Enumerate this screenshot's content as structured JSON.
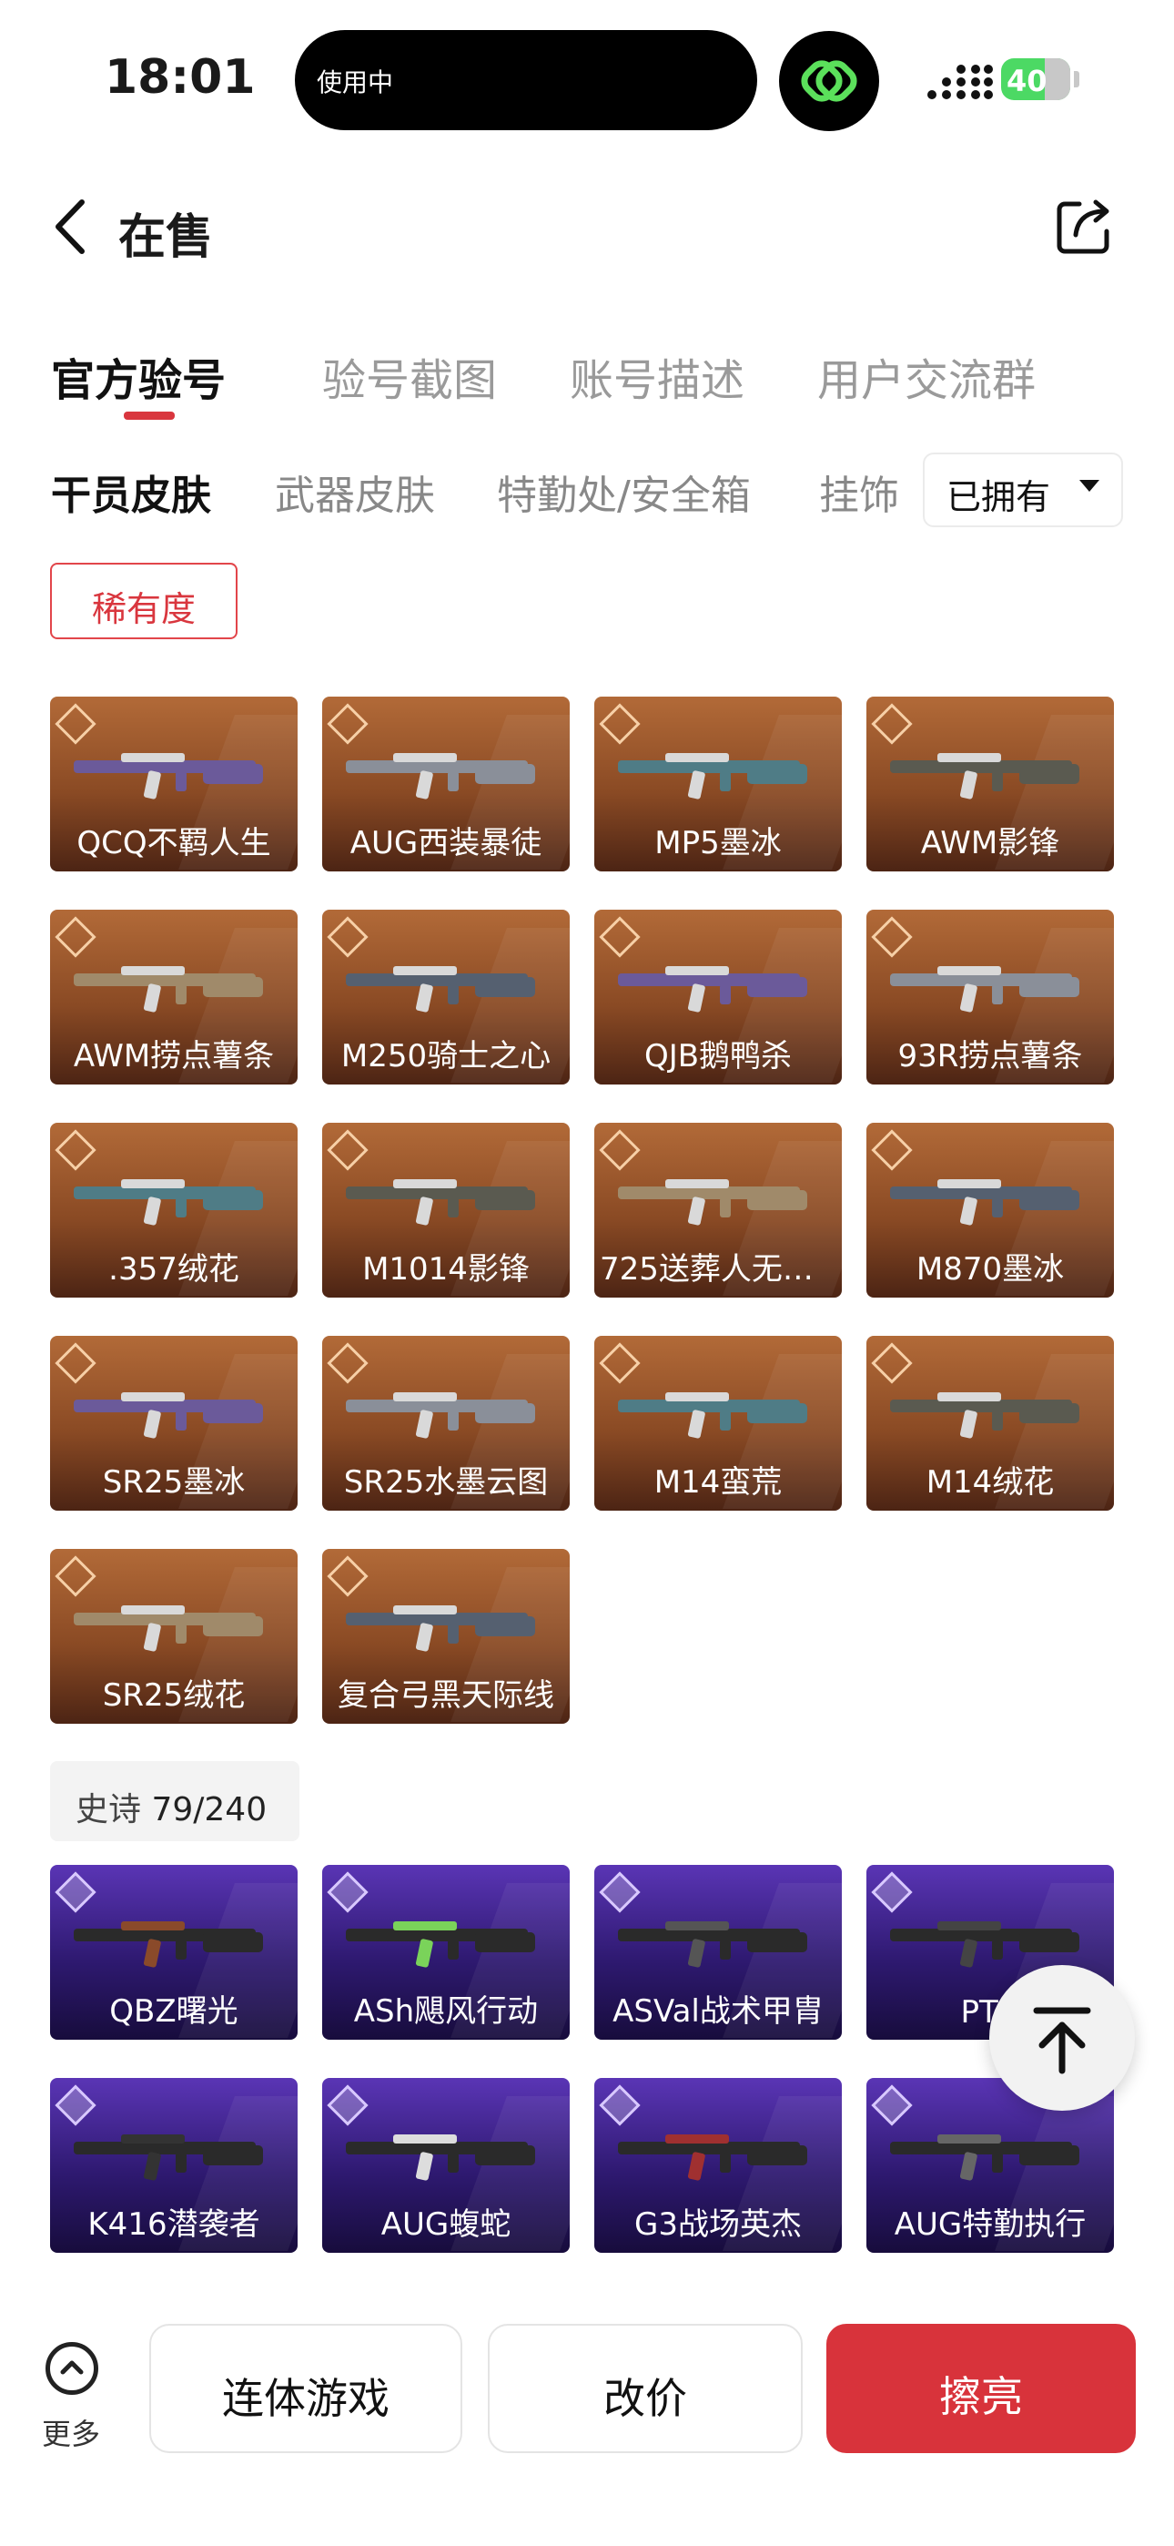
{
  "status_bar": {
    "time": "18:01",
    "island_text": "使用中",
    "battery": "40"
  },
  "header": {
    "title": "在售"
  },
  "main_tabs": [
    {
      "label": "官方验号",
      "active": true
    },
    {
      "label": "验号截图",
      "active": false
    },
    {
      "label": "账号描述",
      "active": false
    },
    {
      "label": "用户交流群",
      "active": false
    }
  ],
  "sub_tabs": [
    {
      "label": "干员皮肤",
      "active": true
    },
    {
      "label": "武器皮肤",
      "active": false
    },
    {
      "label": "特勤处/安全箱",
      "active": false
    },
    {
      "label": "挂饰",
      "active": false
    }
  ],
  "owned_filter": {
    "selected": "已拥有"
  },
  "rarity_filter": "稀有度",
  "legendary_items": [
    "QCQ不羁人生",
    "AUG西装暴徒",
    "MP5墨冰",
    "AWM影锋",
    "AWM捞点薯条",
    "M250骑士之心",
    "QJB鹅鸭杀",
    "93R捞点薯条",
    ".357绒花",
    "M1014影锋",
    "725送葬人无题...",
    "M870墨冰",
    "SR25墨冰",
    "SR25水墨云图",
    "M14蛮荒",
    "M14绒花",
    "SR25绒花",
    "复合弓黑天际线"
  ],
  "epic_section": {
    "label": "史诗",
    "count": "79/240"
  },
  "epic_items": [
    "QBZ曙光",
    "ASh飓风行动",
    "ASVal战术甲胄",
    "PTR",
    "K416潜袭者",
    "AUG蝮蛇",
    "G3战场英杰",
    "AUG特勤执行"
  ],
  "bottom_bar": {
    "more_label": "更多",
    "btn_game": "连体游戏",
    "btn_price": "改价",
    "btn_polish": "擦亮"
  },
  "colors": {
    "accent": "#d8333b",
    "legendary": "#8a4a24",
    "epic": "#2e1970"
  }
}
